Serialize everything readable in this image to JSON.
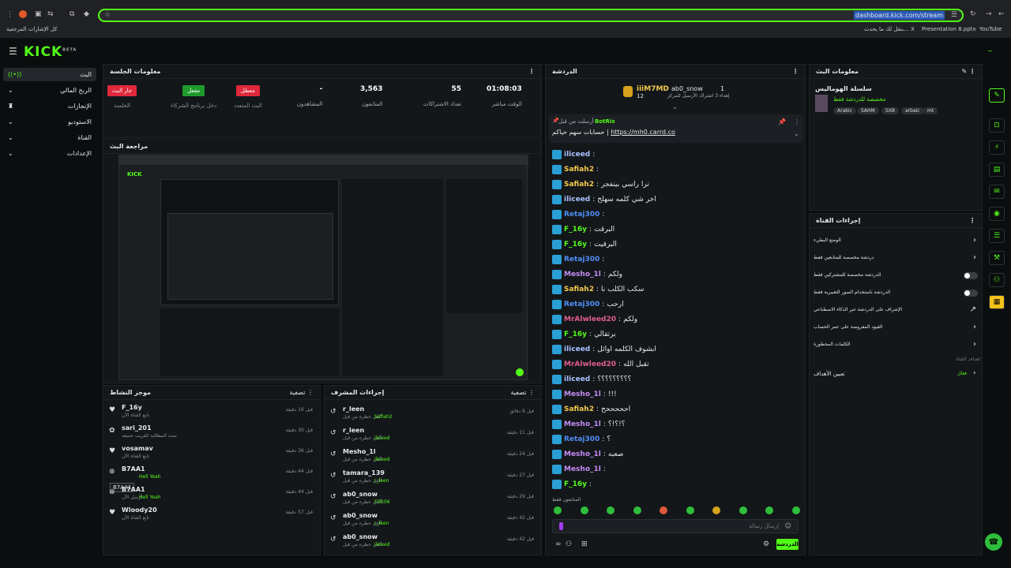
{
  "browser": {
    "url": "dashboard.kick.com/stream",
    "bookmarks_left": "كل الإشارات المرجعية",
    "bookmarks_right": [
      "YouTube",
      "Presentation 8.pptx",
      "بنقل لك ما يحدث... X"
    ]
  },
  "app": {
    "logo": "KICK",
    "logo_sup": "BETA"
  },
  "sidebar": {
    "items": [
      {
        "label": "البث",
        "icon": "broadcast-icon"
      },
      {
        "label": "الربح المالي",
        "icon": "dollar-icon"
      },
      {
        "label": "الإنجازات",
        "icon": "trophy-icon"
      },
      {
        "label": "الاستوديو",
        "icon": "studio-icon"
      },
      {
        "label": "القناة",
        "icon": "channel-icon"
      },
      {
        "label": "الإعدادات",
        "icon": "gear-icon"
      }
    ]
  },
  "session": {
    "title": "معلومات الجلسة",
    "badges": [
      {
        "label": "جار البث",
        "caption": "الجلسة",
        "color": "#e0283b"
      },
      {
        "label": "مفعل",
        "caption": "دخل برنامج الشركاء",
        "color": "#1f9b2e"
      },
      {
        "label": "معطل",
        "caption": "البث المتعدد",
        "color": "#e0283b"
      }
    ],
    "stats": [
      {
        "value": "-",
        "label": "المشاهدون"
      },
      {
        "value": "3,563",
        "label": "المتابعون"
      },
      {
        "value": "55",
        "label": "تعداد الاشتراكات"
      },
      {
        "value": "01:08:03",
        "label": "الوقت مباشر"
      }
    ]
  },
  "preview": {
    "title": "مراجعة البث"
  },
  "activity": {
    "title": "موجز النشاط",
    "filter": "تصفية",
    "items": [
      {
        "user": "F_16y",
        "desc": "تابع القناة الآن",
        "time": "قبل 16 دقيقة",
        "extra": "",
        "icon": "heart-icon"
      },
      {
        "user": "sari_201",
        "desc": "تمت المطالبة القريب جميعه",
        "time": "قبل 30 دقيقة",
        "extra": "",
        "icon": "gift-icon"
      },
      {
        "user": "vosamav",
        "desc": "تابع القناة الآن",
        "time": "قبل 36 دقيقة",
        "extra": "",
        "icon": "heart-icon"
      },
      {
        "user": "B7AA1",
        "desc": "",
        "time": "قبل 44 دقيقة",
        "extra": "Hell Yeah",
        "icon": "kick-icon"
      },
      {
        "user": "B7AA1",
        "desc": "أرسل الآن",
        "time": "قبل 44 دقيقة",
        "extra": "Hell Yeah",
        "icon": "kick-icon"
      },
      {
        "user": "Wloody20",
        "desc": "تابع القناة الآن",
        "time": "قبل 57 دقيقة",
        "extra": "",
        "icon": "heart-icon"
      }
    ],
    "tooltip": "B7AA1"
  },
  "moderation": {
    "title": "إجراءات المشرف",
    "filter": "تصفية",
    "items": [
      {
        "user": "r_leen",
        "by": "Safiah2",
        "time": "قبل 9 دقائق"
      },
      {
        "user": "r_leen",
        "by": "iliceed",
        "time": "قبل 11 دقيقة"
      },
      {
        "user": "Mesho_1l",
        "by": "iliceed",
        "time": "قبل 24 دقيقة"
      },
      {
        "user": "tamara_139",
        "by": "r_leen",
        "time": "قبل 27 دقيقة"
      },
      {
        "user": "ab0_snow",
        "by": "FD506",
        "time": "قبل 29 دقيقة"
      },
      {
        "user": "ab0_snow",
        "by": "r_leen",
        "time": "قبل 42 دقيقة"
      },
      {
        "user": "ab0_snow",
        "by": "iliceed",
        "time": "قبل 42 دقيقة"
      }
    ],
    "desc": "ألغي حظره من قبل"
  },
  "chat": {
    "title": "الدردشة",
    "top_gifter": "iiiM7MD",
    "top_gifter_count": "12",
    "second": "ab0_snow",
    "second_count": "1",
    "second_desc": "إهداء 3 اشتراك الأرسيل للمركز",
    "pinned_by": "أرسلت من قبل",
    "pinned_user": "BotRix",
    "pinned_msg": "حسابات سهم حياكم",
    "pinned_link": "https://mh0.carrd.co",
    "messages": [
      {
        "user": "iliceed",
        "text": "",
        "color": "#a9c1ff"
      },
      {
        "user": "Safiah2",
        "text": "",
        "color": "#f2c94c"
      },
      {
        "user": "Safiah2",
        "text": "ترا راسي بينفجر",
        "color": "#f2c94c"
      },
      {
        "user": "iliceed",
        "text": "اخر شي كلمه سهلخ",
        "color": "#a9c1ff"
      },
      {
        "user": "Retaj300",
        "text": "",
        "color": "#4f8ef7"
      },
      {
        "user": "F_16y",
        "text": "البرقت",
        "color": "#53fc18"
      },
      {
        "user": "F_16y",
        "text": "البرقيت",
        "color": "#53fc18"
      },
      {
        "user": "Retaj300",
        "text": "",
        "color": "#4f8ef7"
      },
      {
        "user": "Mesho_1l",
        "text": "ولكم",
        "color": "#c58cf7"
      },
      {
        "user": "Safiah2",
        "text": "سكب الكلب نا",
        "color": "#f2c94c"
      },
      {
        "user": "Retaj300",
        "text": "ارحب",
        "color": "#4f8ef7"
      },
      {
        "user": "MrAlwleed20",
        "text": "ولكم",
        "color": "#e05c8e"
      },
      {
        "user": "F_16y",
        "text": "برتقالي",
        "color": "#53fc18"
      },
      {
        "user": "iliceed",
        "text": "ابشوف الكلمه اوائل",
        "color": "#a9c1ff"
      },
      {
        "user": "MrAlwleed20",
        "text": "تقبل الله",
        "color": "#e05c8e"
      },
      {
        "user": "iliceed",
        "text": "؟؟؟؟؟؟؟؟؟",
        "color": "#a9c1ff"
      },
      {
        "user": "Mesho_1l",
        "text": "!!!",
        "color": "#c58cf7"
      },
      {
        "user": "Safiah2",
        "text": "احححححح",
        "color": "#f2c94c"
      },
      {
        "user": "Mesho_1l",
        "text": "؟!؟!؟",
        "color": "#c58cf7"
      },
      {
        "user": "Retaj300",
        "text": "؟",
        "color": "#4f8ef7"
      },
      {
        "user": "Mesho_1l",
        "text": "صعبه",
        "color": "#c58cf7"
      },
      {
        "user": "Mesho_1l",
        "text": "",
        "color": "#c58cf7"
      },
      {
        "user": "F_16y",
        "text": "",
        "color": "#53fc18"
      }
    ],
    "followers_only": "المتابعون فقط",
    "placeholder": "إرسال رسالة",
    "send": "الدردشة"
  },
  "stream_info": {
    "title": "معلومات البث",
    "stream_title": "سلسلة الهوماليس",
    "category": "مخصصة للدردشة فقط",
    "tags": [
      "Arabic",
      "SAHM",
      "SXB",
      "arbaic",
      "mt"
    ]
  },
  "channel_actions": {
    "title": "إجراءات القناة",
    "items": [
      "الوضع البطيء",
      "دردشة مخصصة للمتابعين فقط",
      "الدردشة مخصصة للمشتركين فقط",
      "الدردشة باستخدام الصور التعبيرية فقط",
      "الإشراف على الدردشة عبر الذكاء الاصطناعي",
      "القيود المفروضة على عمر الحساب",
      "الكلمات المحظورة"
    ],
    "goals_label": "اهداف القناة",
    "goals": "تعيين الأهداف",
    "goals_state": "فعال"
  }
}
